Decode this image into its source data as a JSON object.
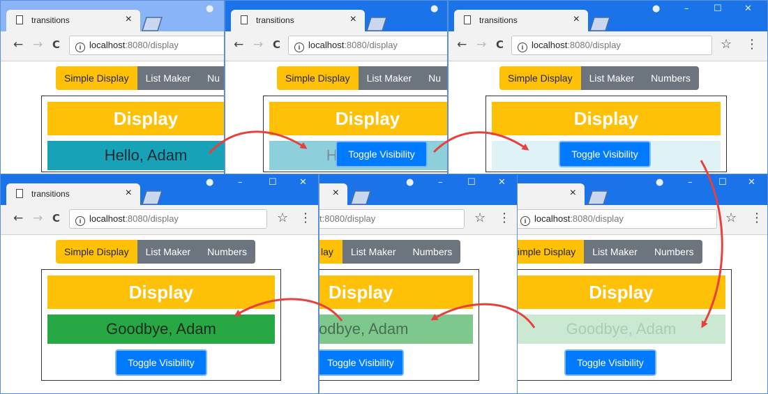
{
  "browser": {
    "tab_title": "transitions",
    "url_host": "localhost",
    "url_rest": ":8080/display",
    "url_partial": "t:8080/display",
    "close_glyph": "×",
    "back": "←",
    "forward": "→",
    "reload": "C",
    "star": "☆",
    "menu": "⋮",
    "minimize": "–",
    "maximize": "☐",
    "close": "✕",
    "profile": "●"
  },
  "app": {
    "nav": [
      "Simple Display",
      "List Maker",
      "Numbers"
    ],
    "nav_partial_top": "Nu",
    "nav_partial_mid": "lay",
    "nav_partial_right": "imple Display",
    "header": "Display",
    "hello": "Hello, Adam",
    "goodbye": "Goodbye, Adam",
    "goodbye_partial": "odbye, Adam",
    "toggle": "Toggle Visibility"
  },
  "colors": {
    "chrome": "#1a73e8",
    "accent_yellow": "#ffc107",
    "hello_full": "#17a2b8",
    "hello_mid": "#8dd0dc",
    "hello_faint": "#dff2f5",
    "goodbye_full": "#28a745",
    "goodbye_mid": "#7cc88d",
    "goodbye_faint": "#cbe8d2",
    "arrow": "#e8403c"
  }
}
